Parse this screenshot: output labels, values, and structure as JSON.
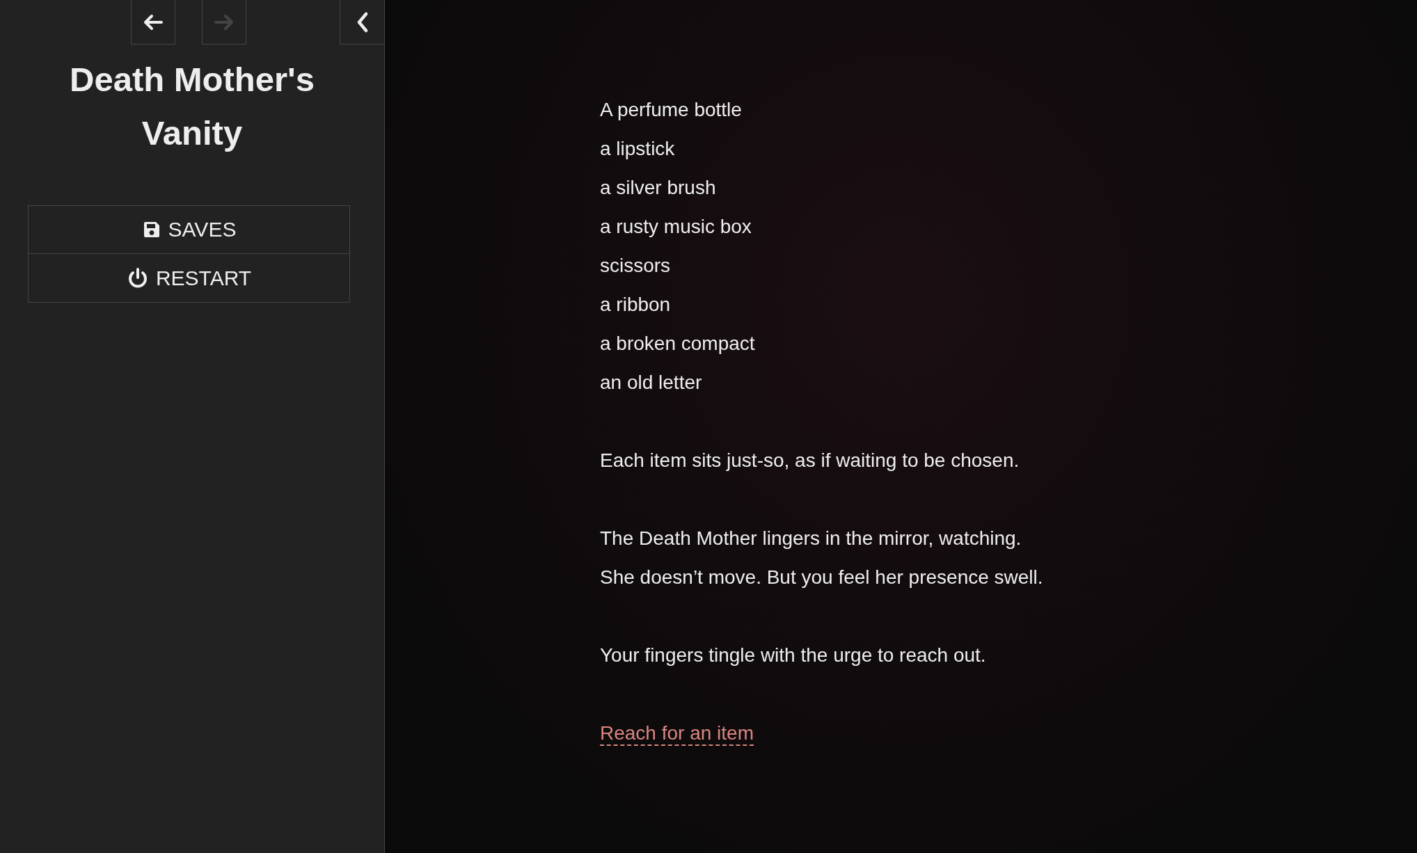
{
  "sidebar": {
    "history": [
      {
        "kind": "back",
        "disabled": false
      },
      {
        "kind": "forward",
        "disabled": true
      }
    ],
    "collapse": {
      "kind": "collapse"
    },
    "story_title": "Death Mother's Vanity",
    "menu": [
      {
        "kind": "saves",
        "label": "SAVES"
      },
      {
        "kind": "restart",
        "label": "RESTART"
      }
    ]
  },
  "passage": {
    "paragraphs": [
      [
        "A perfume bottle",
        "a lipstick",
        "a silver brush",
        "a rusty music box",
        "scissors",
        "a ribbon",
        "a broken compact",
        "an old letter"
      ],
      [
        "Each item sits just-so, as if waiting to be chosen."
      ],
      [
        "The Death Mother lingers in the mirror, watching.",
        "She doesn’t move. But you feel her presence swell."
      ],
      [
        "Your fingers tingle with the urge to reach out."
      ]
    ],
    "link": "Reach for an item"
  }
}
